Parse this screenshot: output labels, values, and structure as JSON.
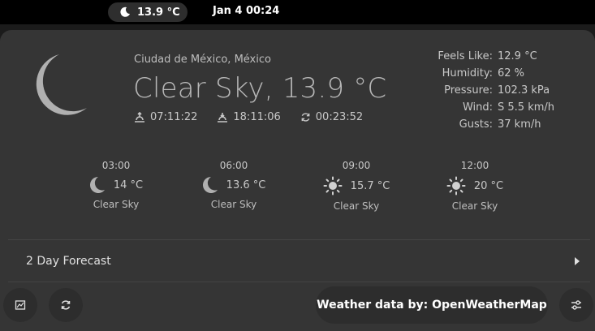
{
  "topbar": {
    "indicator_temp": "13.9 °C",
    "clock": "Jan 4  00:24"
  },
  "current": {
    "location": "Ciudad de México, México",
    "summary": "Clear Sky, 13.9 °C",
    "sunrise": "07:11:22",
    "sunset": "18:11:06",
    "last_refresh": "00:23:52",
    "icon": "crescent-moon-icon"
  },
  "details": [
    {
      "label": "Feels Like:",
      "value": "12.9 °C"
    },
    {
      "label": "Humidity:",
      "value": "62 %"
    },
    {
      "label": "Pressure:",
      "value": "102.3 kPa"
    },
    {
      "label": "Wind:",
      "value": "S 5.5 km/h"
    },
    {
      "label": "Gusts:",
      "value": "37 km/h"
    }
  ],
  "hourly": [
    {
      "time": "03:00",
      "temp": "14 °C",
      "condition": "Clear Sky",
      "icon": "moon-icon"
    },
    {
      "time": "06:00",
      "temp": "13.6 °C",
      "condition": "Clear Sky",
      "icon": "moon-icon"
    },
    {
      "time": "09:00",
      "temp": "15.7 °C",
      "condition": "Clear Sky",
      "icon": "sun-icon"
    },
    {
      "time": "12:00",
      "temp": "20 °C",
      "condition": "Clear Sky",
      "icon": "sun-icon"
    }
  ],
  "forecast_label": "2 Day Forecast",
  "footer": {
    "attribution": "Weather data by: OpenWeatherMap"
  },
  "colors": {
    "panel_bg": "#353535",
    "topbar_bg": "#000000",
    "button_bg": "#2d2d2d",
    "moon_icon": "#b0b0b0"
  }
}
